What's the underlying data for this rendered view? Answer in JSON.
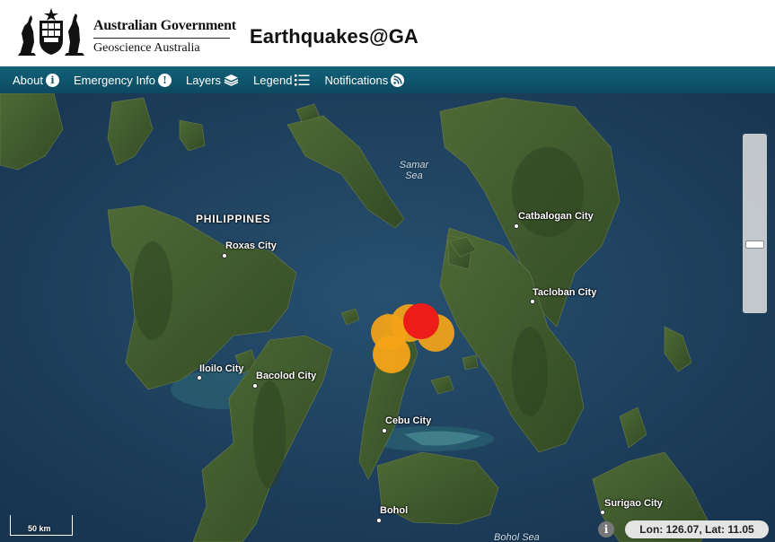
{
  "header": {
    "gov_line1": "Australian Government",
    "gov_line2": "Geoscience Australia",
    "app_title": "Earthquakes@GA"
  },
  "nav": {
    "items": [
      {
        "label": "About",
        "icon": "info-icon"
      },
      {
        "label": "Emergency Info",
        "icon": "exclamation-icon"
      },
      {
        "label": "Layers",
        "icon": "layers-icon"
      },
      {
        "label": "Legend",
        "icon": "list-icon"
      },
      {
        "label": "Notifications",
        "icon": "rss-icon"
      }
    ]
  },
  "map": {
    "country_label": "PHILIPPINES",
    "seas": {
      "samar_line1": "Samar",
      "samar_line2": "Sea",
      "bohol": "Bohol Sea"
    },
    "cities": {
      "roxas": "Roxas City",
      "iloilo": "Iloilo City",
      "bacolod": "Bacolod City",
      "cebu": "Cebu City",
      "bohol": "Bohol",
      "catbalogan": "Catbalogan City",
      "tacloban": "Tacloban City",
      "surigao": "Surigao City"
    },
    "scale_label": "50 km",
    "info_symbol": "i",
    "coords": "Lon: 126.07, Lat: 11.05"
  },
  "colors": {
    "nav_bg": "#0f566c",
    "quake_orange": "#f5a418",
    "quake_red": "#ee1b1b",
    "sea": "#1f3f5c",
    "land": "#3f5a2c"
  }
}
